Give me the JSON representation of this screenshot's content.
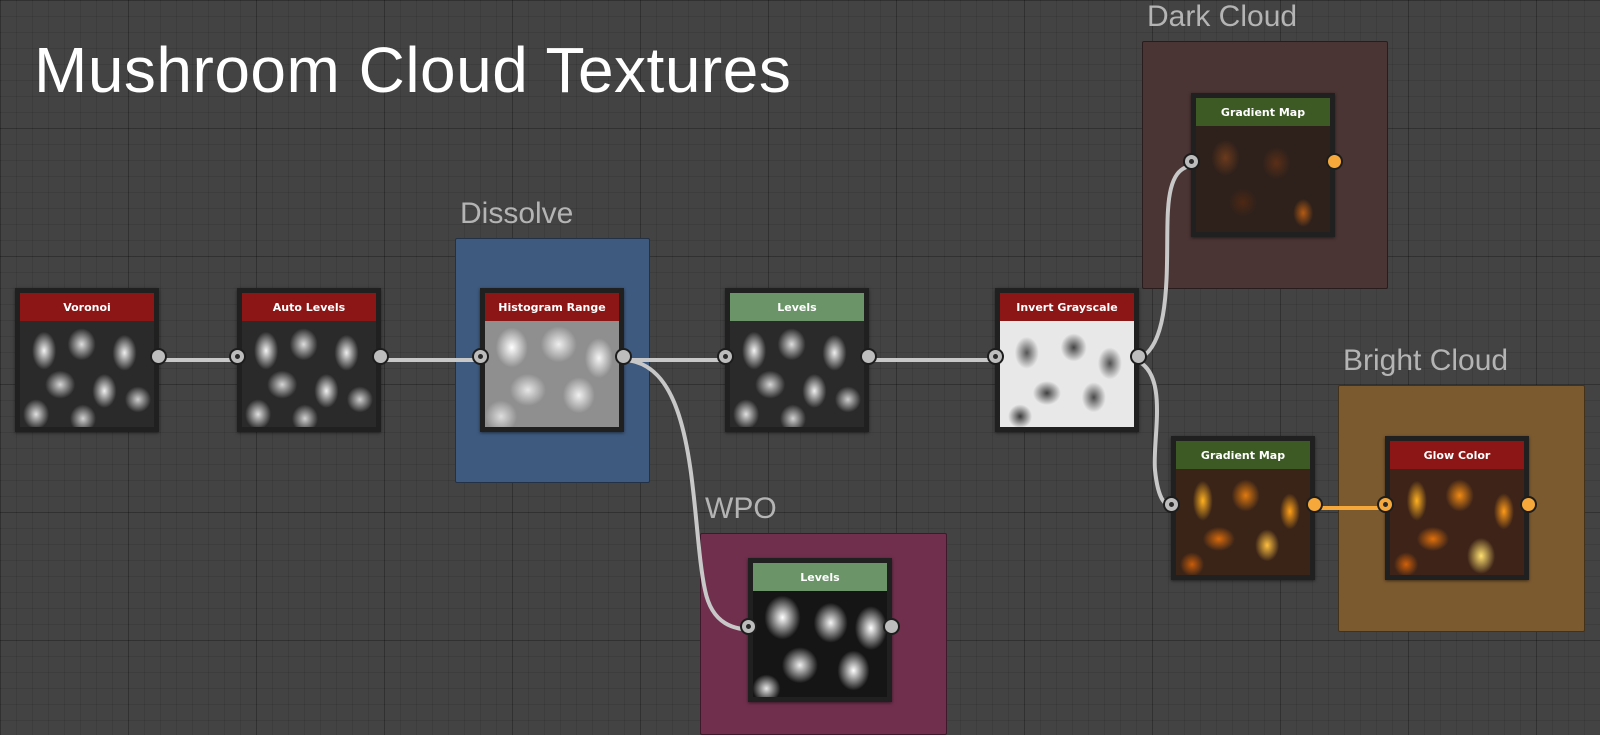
{
  "graph": {
    "title": "Mushroom Cloud Textures"
  },
  "frames": {
    "dissolve": {
      "title": "Dissolve",
      "color": "#3e5a7f"
    },
    "wpo": {
      "title": "WPO",
      "color": "#6f2f4d"
    },
    "dark_cloud": {
      "title": "Dark Cloud",
      "color": "#4a3434"
    },
    "bright_cloud": {
      "title": "Bright Cloud",
      "color": "#7c5a30"
    }
  },
  "nodes": {
    "voronoi": {
      "title": "Voronoi",
      "header_color": "#8c1515"
    },
    "auto_levels": {
      "title": "Auto Levels",
      "header_color": "#8c1515"
    },
    "histogram_range": {
      "title": "Histogram Range",
      "header_color": "#8c1515"
    },
    "levels_main": {
      "title": "Levels",
      "header_color": "#6b9468"
    },
    "invert_grayscale": {
      "title": "Invert Grayscale",
      "header_color": "#8c1515"
    },
    "levels_wpo": {
      "title": "Levels",
      "header_color": "#6b9468"
    },
    "gradient_map_dark": {
      "title": "Gradient Map",
      "header_color": "#3d5a24"
    },
    "gradient_map_bright": {
      "title": "Gradient Map",
      "header_color": "#3d5a24"
    },
    "glow_color": {
      "title": "Glow Color",
      "header_color": "#8c1515"
    }
  },
  "colors": {
    "grayscale_wire": "#c8c8c8",
    "color_wire": "#f6a93a"
  },
  "icons": {
    "input_port": "port-in-icon",
    "output_port": "port-out-icon"
  }
}
